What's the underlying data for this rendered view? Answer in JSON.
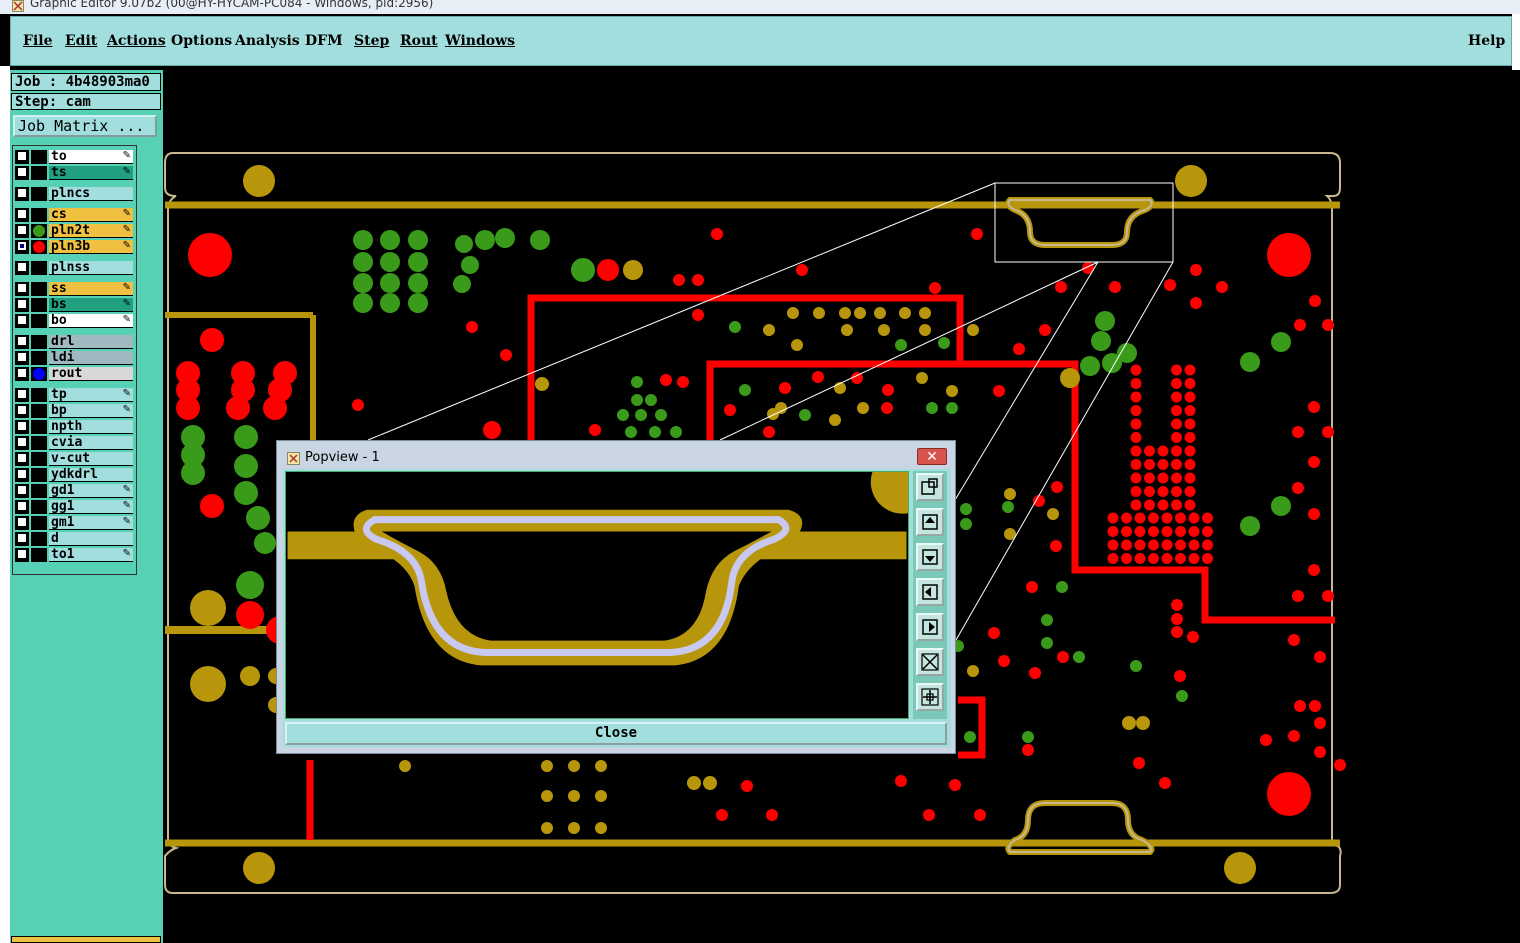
{
  "window": {
    "title": "Graphic Editor 9.07b2 (00@HY-HYCAM-PC084 - Windows, pid:2956)"
  },
  "menu": {
    "items": [
      "File",
      "Edit",
      "Actions",
      "Options",
      "Analysis",
      "DFM",
      "Step",
      "Rout",
      "Windows"
    ],
    "help": "Help"
  },
  "job": {
    "label": "Job : 4b48903ma0",
    "step": "Step: cam",
    "matrix_button": "Job Matrix ..."
  },
  "layers": [
    {
      "name": "to",
      "color": "#ffffff",
      "editable": true
    },
    {
      "name": "ts",
      "color": "#20a080",
      "editable": true
    },
    {
      "name": "plncs",
      "color": "#a3dede",
      "editable": false
    },
    {
      "name": "cs",
      "color": "#f0c040",
      "editable": true
    },
    {
      "name": "pln2t",
      "color": "#f0c040",
      "editable": true,
      "marker": "#3a9a1a"
    },
    {
      "name": "pln3b",
      "color": "#f0c040",
      "editable": true,
      "marker": "#ff0000",
      "active": true
    },
    {
      "name": "plnss",
      "color": "#a3dede",
      "editable": false
    },
    {
      "name": "ss",
      "color": "#f0c040",
      "editable": true
    },
    {
      "name": "bs",
      "color": "#20a080",
      "editable": true
    },
    {
      "name": "bo",
      "color": "#ffffff",
      "editable": true
    },
    {
      "name": "drl",
      "color": "#a0b8c0",
      "editable": false
    },
    {
      "name": "ldi",
      "color": "#a0b8c0",
      "editable": false
    },
    {
      "name": "rout",
      "color": "#d8d8d8",
      "editable": false,
      "marker": "#0000ff"
    },
    {
      "name": "tp",
      "color": "#a3dede",
      "editable": true
    },
    {
      "name": "bp",
      "color": "#a3dede",
      "editable": true
    },
    {
      "name": "npth",
      "color": "#a3dede",
      "editable": false
    },
    {
      "name": "cvia",
      "color": "#a3dede",
      "editable": false
    },
    {
      "name": "v-cut",
      "color": "#a3dede",
      "editable": false
    },
    {
      "name": "ydkdrl",
      "color": "#a3dede",
      "editable": false
    },
    {
      "name": "gd1",
      "color": "#a3dede",
      "editable": true
    },
    {
      "name": "gg1",
      "color": "#a3dede",
      "editable": true
    },
    {
      "name": "gm1",
      "color": "#a3dede",
      "editable": true
    },
    {
      "name": "d",
      "color": "#a3dede",
      "editable": false
    },
    {
      "name": "to1",
      "color": "#a3dede",
      "editable": true
    }
  ],
  "popup": {
    "title": "Popview - 1",
    "close_label": "Close"
  },
  "colors": {
    "gold": "#b8960c",
    "red": "#ff0000",
    "green": "#3a9a1a",
    "outline": "#c8b890",
    "lavender": "#c8c8f0"
  }
}
